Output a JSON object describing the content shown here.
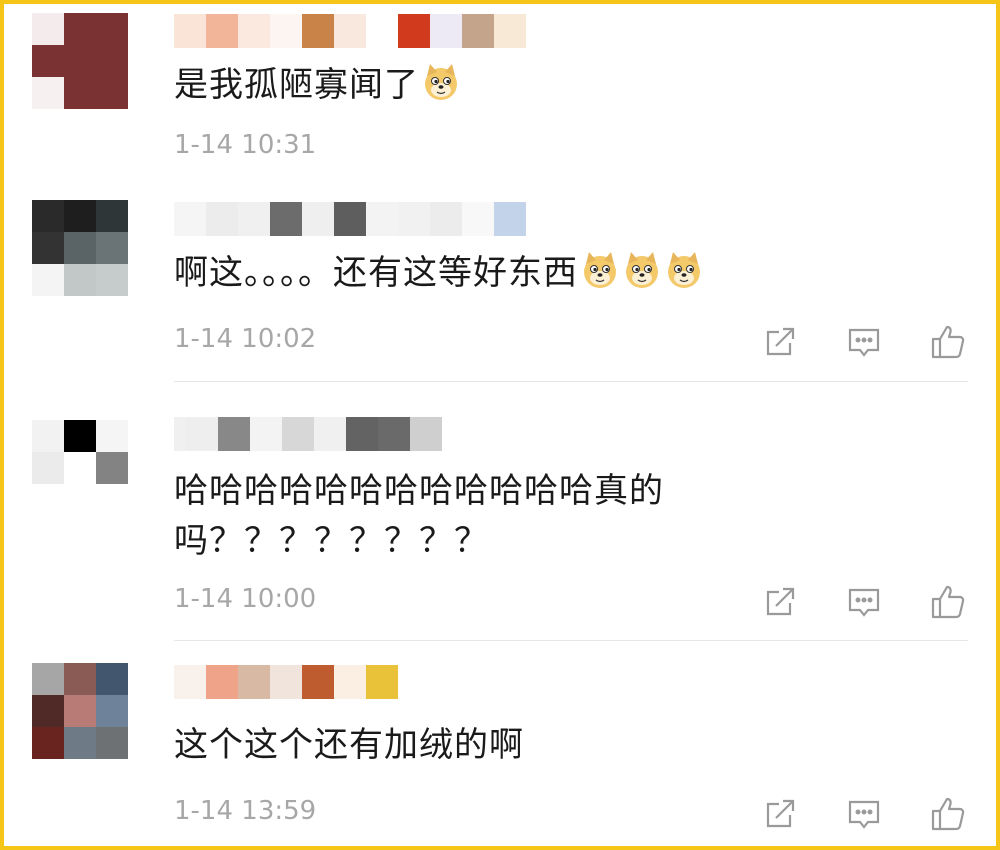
{
  "comments": [
    {
      "text_lines": [
        "是我孤陋寡闻了"
      ],
      "emojis": [
        "doge"
      ],
      "time": "1-14 10:31",
      "show_actions": false
    },
    {
      "text_lines": [
        "啊这。。。。还有这等好东西"
      ],
      "emojis": [
        "doge",
        "doge",
        "doge"
      ],
      "time": "1-14 10:02",
      "show_actions": true
    },
    {
      "text_lines": [
        "哈哈哈哈哈哈哈哈哈哈哈哈真的",
        "吗？？？？？？？？"
      ],
      "emojis": [],
      "time": "1-14 10:00",
      "show_actions": true
    },
    {
      "text_lines": [
        "这个这个还有加绒的啊"
      ],
      "emojis": [],
      "time": "1-14 13:59",
      "show_actions": true
    }
  ],
  "icons": {
    "share": "share-icon",
    "comment": "comment-icon",
    "like": "thumbs-up-icon",
    "emoji": "doge-emoji"
  },
  "colors": {
    "border": "#f5c518",
    "text": "#1a1a1a",
    "timestamp": "#a7a7a7",
    "icon": "#9a9a9a"
  }
}
